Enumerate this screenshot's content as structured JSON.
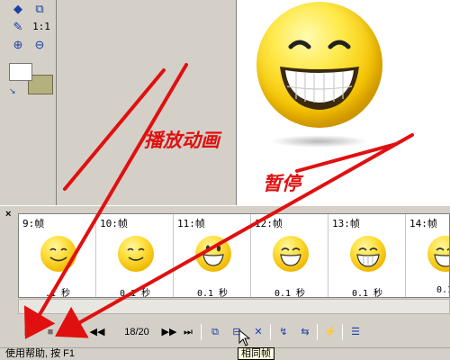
{
  "toolbox": {
    "tools": [
      {
        "name": "shape-select-icon",
        "glyph": "◆"
      },
      {
        "name": "crop-icon",
        "glyph": "⧉"
      },
      {
        "name": "eyedropper-icon",
        "glyph": "✎"
      },
      {
        "name": "actual-size",
        "glyph": "1:1"
      },
      {
        "name": "zoom-in-icon",
        "glyph": "⊕"
      },
      {
        "name": "zoom-out-icon",
        "glyph": "⊖"
      }
    ],
    "colors": {
      "foreground": "#ffffff",
      "background": "#b4b17e"
    }
  },
  "frames": [
    {
      "label": "9:帧",
      "delay": ".1 秒"
    },
    {
      "label": "10:帧",
      "delay": "0.1 秒"
    },
    {
      "label": "11:帧",
      "delay": "0.1 秒"
    },
    {
      "label": "12:帧",
      "delay": "0.1 秒"
    },
    {
      "label": "13:帧",
      "delay": "0.1 秒"
    },
    {
      "label": "14:帧",
      "delay": "0.1"
    }
  ],
  "playback": {
    "counter": "18/20",
    "buttons": {
      "play": "▶",
      "stop": "■",
      "first": "⏮",
      "prev": "◀◀",
      "next": "▶▶",
      "last": "⏭",
      "copy_frame": "⧉",
      "same_frame": "⊟",
      "delete_frame": "✕",
      "tween": "↯",
      "reverse": "⇆",
      "optimize": "⚡",
      "properties": "☰"
    }
  },
  "tooltip": "相同帧",
  "status": "使用帮助, 按 F1",
  "annotations": {
    "play_label": "播放动画",
    "pause_label": "暂停"
  },
  "annotation_color": "#e01010"
}
